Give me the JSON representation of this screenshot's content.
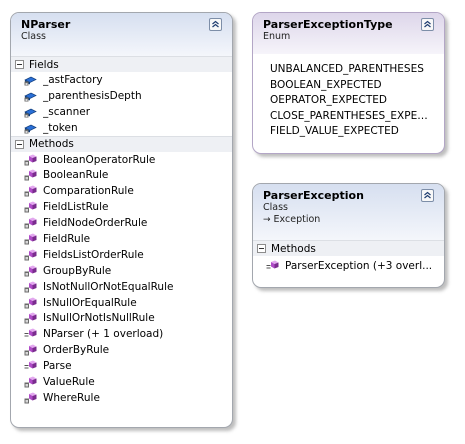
{
  "nparser": {
    "name": "NParser",
    "kind": "Class",
    "fields_label": "Fields",
    "fields": [
      "_astFactory",
      "_parenthesisDepth",
      "_scanner",
      "_token"
    ],
    "methods_label": "Methods",
    "methods": [
      {
        "label": "BooleanOperatorRule",
        "icon": "private-method-icon"
      },
      {
        "label": "BooleanRule",
        "icon": "private-method-icon"
      },
      {
        "label": "ComparationRule",
        "icon": "private-method-icon"
      },
      {
        "label": "FieldListRule",
        "icon": "private-method-icon"
      },
      {
        "label": "FieldNodeOrderRule",
        "icon": "private-method-icon"
      },
      {
        "label": "FieldRule",
        "icon": "private-method-icon"
      },
      {
        "label": "FieldsListOrderRule",
        "icon": "private-method-icon"
      },
      {
        "label": "GroupByRule",
        "icon": "private-method-icon"
      },
      {
        "label": "IsNotNullOrNotEqualRule",
        "icon": "private-method-icon"
      },
      {
        "label": "IsNullOrEqualRule",
        "icon": "private-method-icon"
      },
      {
        "label": "IsNullOrNotIsNullRule",
        "icon": "private-method-icon"
      },
      {
        "label": "NParser (+ 1 overload)",
        "icon": "public-method-icon"
      },
      {
        "label": "OrderByRule",
        "icon": "private-method-icon"
      },
      {
        "label": "Parse",
        "icon": "public-method-icon"
      },
      {
        "label": "ValueRule",
        "icon": "private-method-icon"
      },
      {
        "label": "WhereRule",
        "icon": "private-method-icon"
      }
    ]
  },
  "parser_exception_type": {
    "name": "ParserExceptionType",
    "kind": "Enum",
    "values": [
      "UNBALANCED_PARENTHESES",
      "BOOLEAN_EXPECTED",
      "OEPRATOR_EXPECTED",
      "CLOSE_PARENTHESES_EXPECT...",
      "FIELD_VALUE_EXPECTED"
    ]
  },
  "parser_exception": {
    "name": "ParserException",
    "kind": "Class",
    "base": "Exception",
    "methods_label": "Methods",
    "methods": [
      {
        "label": "ParserException (+3 overl...",
        "icon": "public-method-icon"
      }
    ]
  },
  "colors": {
    "class_header": "#d6dff0",
    "enum_header": "#ddd6ea",
    "method_icon": "#b04bc8",
    "field_icon": "#2a6fd6"
  }
}
